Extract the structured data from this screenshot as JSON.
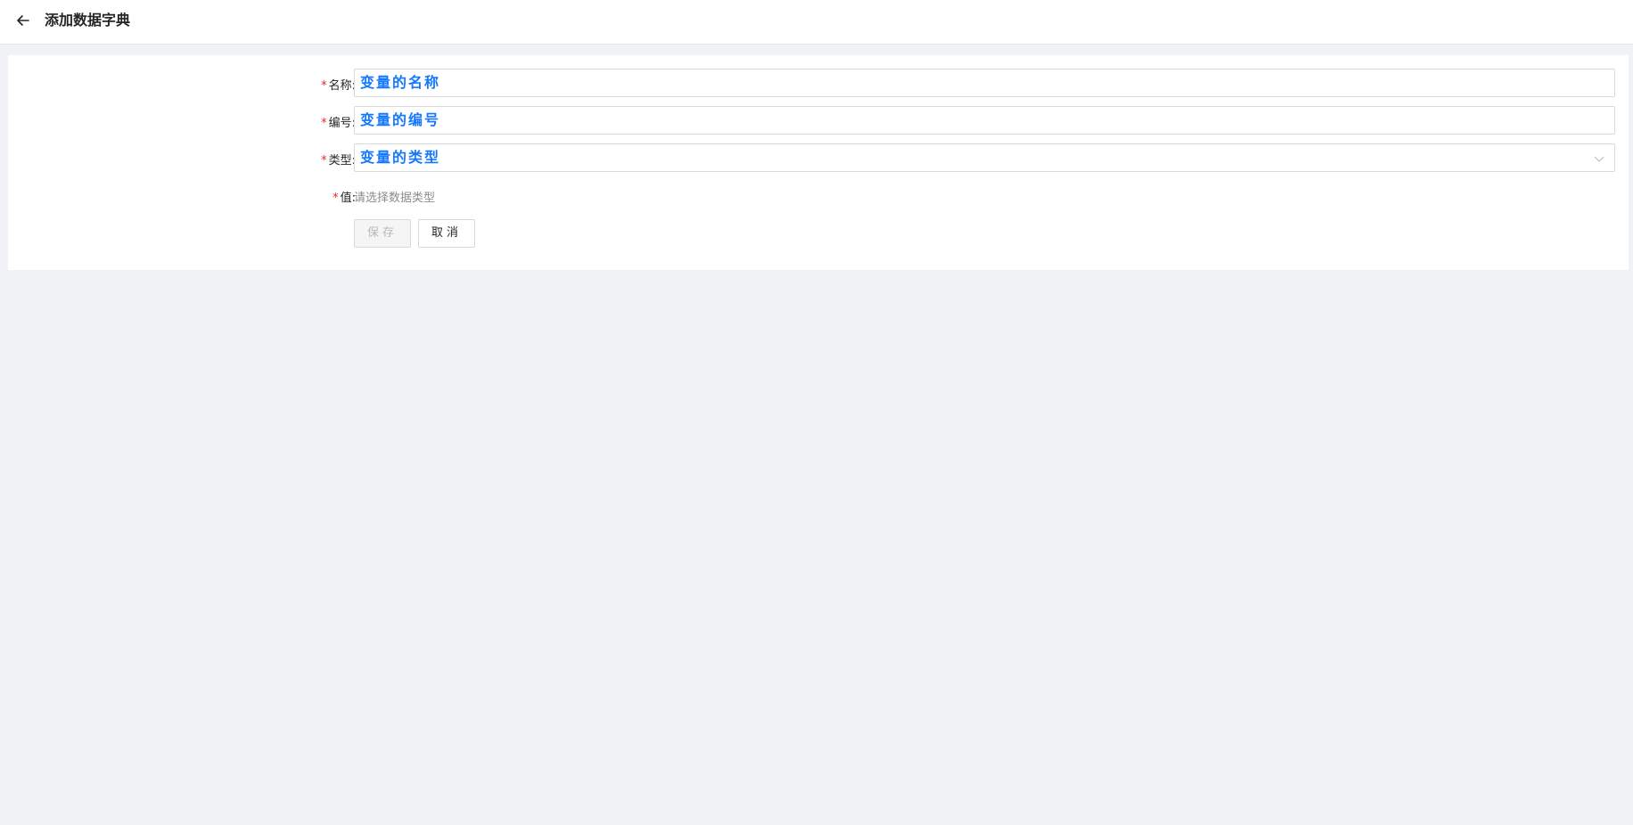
{
  "header": {
    "title": "添加数据字典",
    "back_icon": "arrow-left-icon"
  },
  "form": {
    "name": {
      "required_mark": "*",
      "label": "名称:",
      "value": "变量的名称"
    },
    "code": {
      "required_mark": "*",
      "label": "编号:",
      "value": "变量的编号"
    },
    "type": {
      "required_mark": "*",
      "label": "类型:",
      "value": "变量的类型",
      "dropdown_icon": "chevron-down-icon"
    },
    "value": {
      "required_mark": "*",
      "label": "值:",
      "hint": "请选择数据类型"
    },
    "buttons": {
      "save": "保存",
      "cancel": "取消"
    }
  },
  "colors": {
    "background": "#f0f2f5",
    "accent_text": "#1677ff",
    "required": "#f5222d"
  }
}
